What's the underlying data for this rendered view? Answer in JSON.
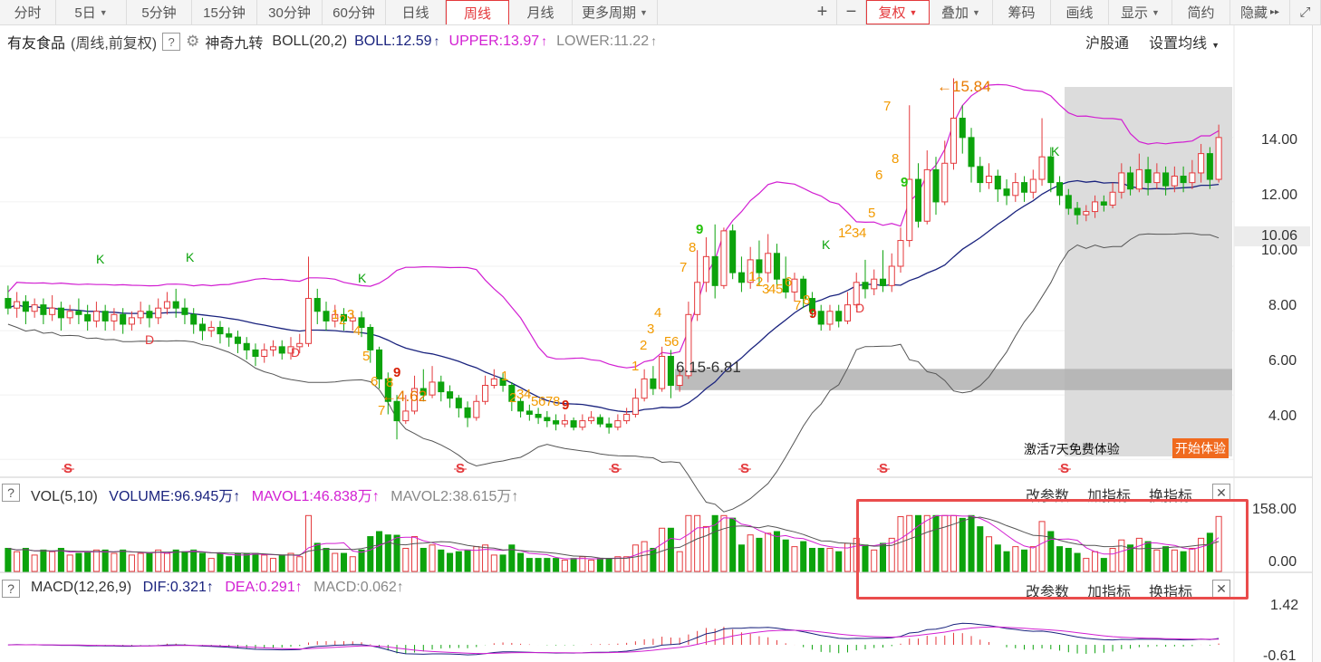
{
  "toolbar": {
    "left_items": [
      {
        "label": "分时",
        "active": false
      },
      {
        "label": "5日",
        "dropdown": true
      },
      {
        "label": "5分钟"
      },
      {
        "label": "15分钟"
      },
      {
        "label": "30分钟"
      },
      {
        "label": "60分钟"
      },
      {
        "label": "日线"
      },
      {
        "label": "周线",
        "active": true
      },
      {
        "label": "月线"
      },
      {
        "label": "更多周期",
        "dropdown": true
      }
    ],
    "right_items": [
      {
        "label": "+",
        "name": "zoom-in-button"
      },
      {
        "label": "−",
        "name": "zoom-out-button"
      },
      {
        "label": "复权",
        "dropdown": true,
        "highlight": true,
        "name": "adjust-button"
      },
      {
        "label": "叠加",
        "dropdown": true,
        "name": "overlay-button"
      },
      {
        "label": "筹码",
        "name": "chips-button"
      },
      {
        "label": "画线",
        "name": "draw-line-button"
      },
      {
        "label": "显示",
        "dropdown": true,
        "name": "display-button"
      },
      {
        "label": "简约",
        "name": "simple-button"
      },
      {
        "label": "隐藏",
        "name": "hide-button",
        "suffix": "▸▸"
      },
      {
        "label": "⤢",
        "name": "fullscreen-button"
      }
    ]
  },
  "info": {
    "stock_name": "有友食品",
    "mode": "(周线,前复权)",
    "help": "?",
    "indicator": "神奇九转",
    "boll_label": "BOLL(20,2)",
    "boll_value": "BOLL:12.59",
    "upper_value": "UPPER:13.97",
    "lower_value": "LOWER:11.22",
    "hgt": "沪股通",
    "set_ma": "设置均线"
  },
  "main_panel": {
    "y_ticks": [
      "14.00",
      "12.00",
      "10.00",
      "8.00",
      "6.00",
      "4.00"
    ],
    "current_price": "10.06",
    "low_annotation": "←4.62",
    "high_annotation": "←15.84",
    "zone_label": "6.15-6.81",
    "trial_text": "激活7天免费体验",
    "trial_button": "开始体验"
  },
  "volume_panel": {
    "title": "VOL(5,10)",
    "volume": "VOLUME:96.945万",
    "mavol1": "MAVOL1:46.838万",
    "mavol2": "MAVOL2:38.615万",
    "y_top": "158.00",
    "y_bottom": "0.00",
    "change_params": "改参数",
    "add_indicator": "加指标",
    "swap_indicator": "换指标"
  },
  "macd_panel": {
    "title": "MACD(12,26,9)",
    "dif": "DIF:0.321",
    "dea": "DEA:0.291",
    "macd": "MACD:0.062",
    "y_top": "1.42",
    "y_bottom": "-0.61",
    "change_params": "改参数",
    "add_indicator": "加指标",
    "swap_indicator": "换指标"
  },
  "colors": {
    "up": "#e4393c",
    "down": "#0ca30c",
    "mid_line": "#1a237e",
    "upper_line": "#d21fd2",
    "lower_line": "#555555",
    "td_seq": "#f29a00",
    "td_nine": "#d81e06",
    "td_green": "#25c10b"
  },
  "chart_data": {
    "type": "candlestick",
    "period": "weekly",
    "ylim": [
      3.5,
      16.5
    ],
    "candles": [
      [
        9.0,
        8.7,
        9.4,
        8.5
      ],
      [
        8.7,
        8.9,
        9.2,
        8.4
      ],
      [
        8.9,
        8.6,
        9.1,
        8.2
      ],
      [
        8.6,
        8.8,
        9.0,
        8.4
      ],
      [
        8.8,
        8.5,
        9.0,
        8.2
      ],
      [
        8.5,
        8.7,
        9.1,
        8.3
      ],
      [
        8.7,
        8.4,
        8.9,
        8.0
      ],
      [
        8.4,
        8.6,
        8.8,
        8.2
      ],
      [
        8.6,
        8.5,
        9.0,
        8.2
      ],
      [
        8.5,
        8.3,
        8.8,
        8.0
      ],
      [
        8.3,
        8.6,
        8.9,
        8.1
      ],
      [
        8.6,
        8.3,
        8.8,
        8.0
      ],
      [
        8.3,
        8.5,
        8.7,
        8.0
      ],
      [
        8.5,
        8.2,
        8.7,
        7.9
      ],
      [
        8.2,
        8.4,
        8.6,
        8.0
      ],
      [
        8.4,
        8.6,
        8.9,
        8.2
      ],
      [
        8.6,
        8.4,
        8.8,
        8.1
      ],
      [
        8.4,
        8.7,
        9.0,
        8.2
      ],
      [
        8.7,
        8.9,
        9.2,
        8.5
      ],
      [
        8.9,
        8.7,
        9.3,
        8.4
      ],
      [
        8.7,
        8.5,
        9.0,
        8.2
      ],
      [
        8.5,
        8.2,
        8.7,
        7.9
      ],
      [
        8.2,
        8.0,
        8.4,
        7.7
      ],
      [
        8.0,
        8.1,
        8.3,
        7.8
      ],
      [
        8.1,
        7.9,
        8.3,
        7.6
      ],
      [
        7.9,
        7.8,
        8.1,
        7.5
      ],
      [
        7.8,
        7.6,
        8.0,
        7.3
      ],
      [
        7.6,
        7.4,
        7.8,
        7.1
      ],
      [
        7.4,
        7.2,
        7.6,
        6.9
      ],
      [
        7.2,
        7.4,
        7.6,
        7.0
      ],
      [
        7.4,
        7.5,
        7.7,
        7.2
      ],
      [
        7.5,
        7.3,
        7.7,
        7.1
      ],
      [
        7.3,
        7.5,
        7.8,
        7.1
      ],
      [
        7.5,
        7.6,
        7.9,
        7.3
      ],
      [
        7.6,
        9.0,
        10.3,
        7.5
      ],
      [
        9.0,
        8.6,
        9.3,
        8.2
      ],
      [
        8.6,
        8.3,
        8.9,
        8.0
      ],
      [
        8.3,
        8.5,
        8.8,
        8.1
      ],
      [
        8.5,
        8.3,
        8.7,
        8.0
      ],
      [
        8.3,
        8.4,
        8.6,
        8.0
      ],
      [
        8.4,
        8.1,
        8.6,
        7.8
      ],
      [
        8.1,
        7.4,
        8.2,
        7.0
      ],
      [
        7.4,
        6.5,
        7.5,
        6.2
      ],
      [
        6.5,
        5.8,
        6.7,
        5.4
      ],
      [
        5.8,
        5.2,
        6.0,
        4.62
      ],
      [
        5.2,
        5.5,
        6.0,
        5.1
      ],
      [
        5.5,
        6.2,
        6.6,
        5.4
      ],
      [
        6.2,
        6.0,
        6.8,
        5.8
      ],
      [
        6.0,
        6.4,
        6.9,
        5.9
      ],
      [
        6.4,
        6.1,
        6.6,
        5.8
      ],
      [
        6.1,
        5.9,
        6.3,
        5.6
      ],
      [
        5.9,
        5.6,
        6.0,
        5.3
      ],
      [
        5.6,
        5.3,
        5.8,
        5.0
      ],
      [
        5.3,
        5.8,
        6.0,
        5.2
      ],
      [
        5.8,
        6.3,
        6.6,
        5.7
      ],
      [
        6.3,
        6.5,
        6.8,
        6.2
      ],
      [
        6.5,
        6.3,
        6.7,
        6.1
      ],
      [
        6.3,
        5.8,
        6.4,
        5.5
      ],
      [
        5.8,
        5.5,
        5.9,
        5.3
      ],
      [
        5.5,
        5.4,
        5.7,
        5.2
      ],
      [
        5.4,
        5.3,
        5.6,
        5.1
      ],
      [
        5.3,
        5.2,
        5.5,
        5.0
      ],
      [
        5.2,
        5.1,
        5.4,
        4.9
      ],
      [
        5.1,
        5.2,
        5.4,
        5.0
      ],
      [
        5.2,
        5.0,
        5.3,
        4.9
      ],
      [
        5.0,
        5.2,
        5.4,
        4.9
      ],
      [
        5.2,
        5.3,
        5.5,
        5.1
      ],
      [
        5.3,
        5.1,
        5.4,
        5.0
      ],
      [
        5.1,
        5.0,
        5.3,
        4.8
      ],
      [
        5.0,
        5.2,
        5.4,
        4.9
      ],
      [
        5.2,
        5.4,
        5.6,
        5.1
      ],
      [
        5.4,
        5.9,
        6.2,
        5.3
      ],
      [
        5.9,
        6.5,
        6.8,
        5.8
      ],
      [
        6.5,
        6.2,
        6.9,
        6.0
      ],
      [
        6.2,
        7.2,
        7.5,
        6.1
      ],
      [
        7.2,
        6.3,
        7.4,
        5.9
      ],
      [
        6.3,
        6.6,
        6.8,
        6.1
      ],
      [
        6.6,
        8.5,
        8.9,
        6.5
      ],
      [
        8.5,
        9.5,
        10.5,
        8.3
      ],
      [
        9.5,
        10.3,
        10.9,
        9.2
      ],
      [
        10.3,
        9.4,
        11.3,
        9.0
      ],
      [
        9.4,
        11.1,
        11.2,
        9.3
      ],
      [
        11.1,
        9.8,
        11.3,
        9.6
      ],
      [
        9.8,
        9.5,
        10.3,
        9.2
      ],
      [
        9.5,
        10.2,
        10.6,
        9.3
      ],
      [
        10.2,
        9.8,
        10.8,
        9.4
      ],
      [
        9.8,
        10.4,
        11.0,
        9.5
      ],
      [
        10.4,
        9.6,
        10.7,
        9.3
      ],
      [
        9.6,
        9.2,
        10.3,
        9.0
      ],
      [
        9.2,
        9.6,
        9.8,
        8.9
      ],
      [
        9.6,
        9.0,
        9.7,
        8.7
      ],
      [
        9.0,
        8.6,
        9.2,
        8.4
      ],
      [
        8.6,
        8.2,
        8.8,
        8.0
      ],
      [
        8.2,
        8.6,
        8.8,
        8.0
      ],
      [
        8.6,
        8.3,
        8.8,
        8.1
      ],
      [
        8.3,
        8.8,
        9.2,
        8.2
      ],
      [
        8.8,
        9.5,
        9.8,
        8.7
      ],
      [
        9.5,
        9.3,
        10.2,
        9.0
      ],
      [
        9.3,
        9.6,
        9.9,
        9.1
      ],
      [
        9.6,
        9.4,
        10.5,
        9.2
      ],
      [
        9.4,
        10.0,
        10.4,
        9.2
      ],
      [
        10.0,
        10.8,
        11.2,
        9.8
      ],
      [
        10.8,
        12.7,
        15.0,
        10.6
      ],
      [
        12.7,
        11.4,
        13.2,
        11.2
      ],
      [
        11.4,
        13.0,
        13.6,
        11.3
      ],
      [
        13.0,
        12.0,
        13.4,
        11.6
      ],
      [
        12.0,
        13.2,
        13.9,
        11.9
      ],
      [
        13.2,
        14.6,
        15.84,
        13.0
      ],
      [
        14.6,
        14.0,
        15.0,
        13.5
      ],
      [
        14.0,
        13.1,
        14.3,
        12.6
      ],
      [
        13.1,
        12.6,
        13.4,
        12.3
      ],
      [
        12.6,
        12.8,
        13.2,
        12.4
      ],
      [
        12.8,
        12.4,
        13.0,
        12.0
      ],
      [
        12.4,
        12.2,
        12.7,
        11.9
      ],
      [
        12.2,
        12.6,
        12.9,
        12.0
      ],
      [
        12.6,
        12.3,
        12.8,
        12.0
      ],
      [
        12.3,
        12.7,
        13.0,
        12.1
      ],
      [
        12.7,
        13.4,
        14.6,
        12.5
      ],
      [
        13.4,
        12.6,
        13.7,
        12.3
      ],
      [
        12.6,
        12.2,
        12.8,
        11.9
      ],
      [
        12.2,
        11.8,
        12.4,
        11.6
      ],
      [
        11.8,
        11.6,
        12.0,
        11.3
      ],
      [
        11.6,
        11.7,
        11.9,
        11.4
      ],
      [
        11.7,
        12.0,
        12.2,
        11.5
      ],
      [
        12.0,
        11.9,
        12.2,
        11.7
      ],
      [
        11.9,
        12.3,
        12.6,
        11.8
      ],
      [
        12.3,
        12.9,
        13.2,
        12.1
      ],
      [
        12.9,
        12.4,
        13.1,
        12.2
      ],
      [
        12.4,
        13.0,
        13.5,
        12.3
      ],
      [
        13.0,
        12.6,
        13.4,
        12.2
      ],
      [
        12.6,
        12.9,
        13.2,
        12.4
      ],
      [
        12.9,
        12.5,
        13.1,
        12.2
      ],
      [
        12.5,
        12.8,
        13.1,
        12.3
      ],
      [
        12.8,
        12.6,
        13.1,
        12.3
      ],
      [
        12.6,
        12.9,
        13.3,
        12.4
      ],
      [
        12.9,
        13.5,
        13.8,
        12.6
      ],
      [
        13.5,
        12.7,
        13.7,
        12.4
      ],
      [
        12.7,
        14.0,
        14.4,
        12.6
      ]
    ],
    "volume_ylim": [
      0,
      158
    ],
    "macd_ylim": [
      -0.61,
      1.42
    ]
  }
}
